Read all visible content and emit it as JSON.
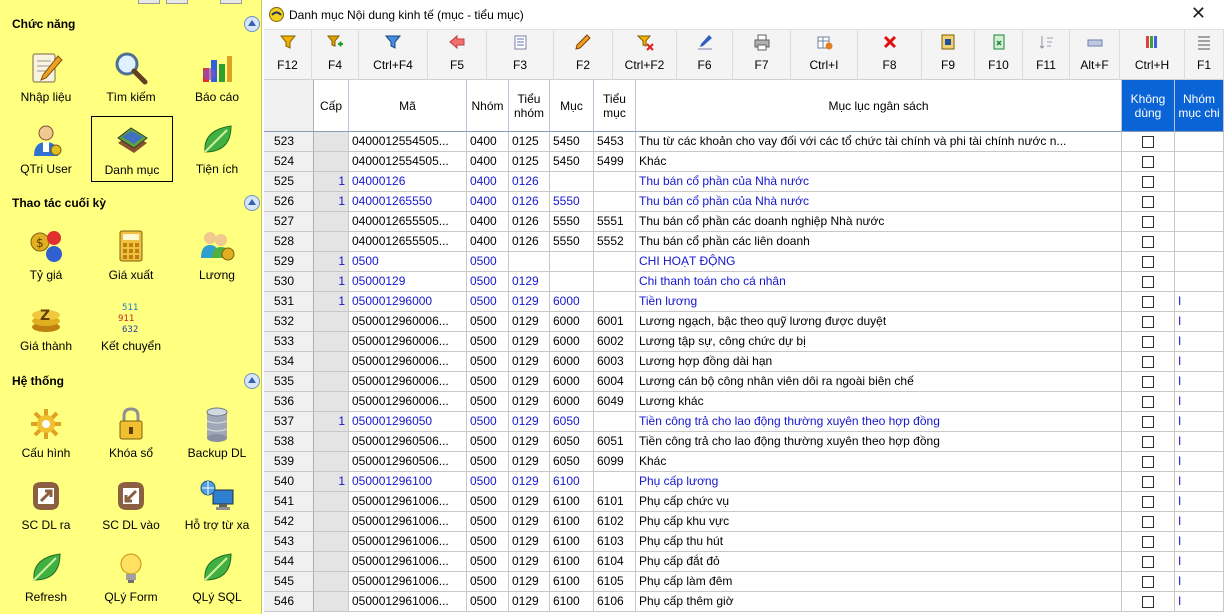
{
  "sidebar": {
    "sections": [
      {
        "title": "Chức năng",
        "items": [
          "Nhập liệu",
          "Tìm kiếm",
          "Báo cáo",
          "QTri User",
          "Danh mục",
          "Tiện ích"
        ]
      },
      {
        "title": "Thao tác cuối kỳ",
        "items": [
          "Tỷ giá",
          "Giá xuất",
          "Lương",
          "Giá thành",
          "Kết chuyển"
        ]
      },
      {
        "title": "Hệ thống",
        "items": [
          "Cấu hình",
          "Khóa sổ",
          "Backup DL",
          "SC DL ra",
          "SC DL vào",
          "Hỗ trợ từ xa",
          "Refresh",
          "QLý Form",
          "QLý SQL"
        ]
      }
    ],
    "selected": "Danh mục"
  },
  "window": {
    "title": "Danh mục Nội dung kinh tế (mục - tiểu mục)",
    "close": "✕"
  },
  "toolbar": [
    "F12",
    "F4",
    "Ctrl+F4",
    "F5",
    "F3",
    "F2",
    "Ctrl+F2",
    "F6",
    "F7",
    "Ctrl+I",
    "F8",
    "F9",
    "F10",
    "F11",
    "Alt+F",
    "Ctrl+H",
    "F1"
  ],
  "grid": {
    "columns": {
      "cap": "Cấp",
      "ma": "Mã",
      "nhom": "Nhóm",
      "tieu_nhom": "Tiểu nhóm",
      "muc": "Mục",
      "tieu_muc": "Tiểu mục",
      "muc_luc": "Mục lục ngân sách",
      "khong_dung": "Không dùng",
      "nhom_muc_chi": "Nhóm mục chi"
    },
    "rows": [
      {
        "n": "523",
        "cap": "",
        "ma": "0400012554505...",
        "nhom": "0400",
        "tn": "0125",
        "muc": "5450",
        "tm": "5453",
        "mlns": " Thu từ các khoản cho vay đối với các tổ chức tài chính và phi tài chính nước n...",
        "nmc": "",
        "blue": false
      },
      {
        "n": "524",
        "cap": "",
        "ma": "0400012554505...",
        "nhom": "0400",
        "tn": "0125",
        "muc": "5450",
        "tm": "5499",
        "mlns": " Khác",
        "nmc": "",
        "blue": false
      },
      {
        "n": "525",
        "cap": "1",
        "ma": "04000126",
        "nhom": "0400",
        "tn": "0126",
        "muc": "",
        "tm": "",
        "mlns": "Thu bán cổ phần của Nhà nước",
        "nmc": "",
        "blue": true
      },
      {
        "n": "526",
        "cap": "1",
        "ma": "040001265550",
        "nhom": "0400",
        "tn": "0126",
        "muc": "5550",
        "tm": "",
        "mlns": "Thu bán cổ phần của Nhà nước",
        "nmc": "",
        "blue": true
      },
      {
        "n": "527",
        "cap": "",
        "ma": "0400012655505...",
        "nhom": "0400",
        "tn": "0126",
        "muc": "5550",
        "tm": "5551",
        "mlns": " Thu bán cổ phần các doanh nghiệp Nhà nước",
        "nmc": "",
        "blue": false
      },
      {
        "n": "528",
        "cap": "",
        "ma": "0400012655505...",
        "nhom": "0400",
        "tn": "0126",
        "muc": "5550",
        "tm": "5552",
        "mlns": " Thu bán cổ phần các liên doanh",
        "nmc": "",
        "blue": false
      },
      {
        "n": "529",
        "cap": "1",
        "ma": "0500",
        "nhom": "0500",
        "tn": "",
        "muc": "",
        "tm": "",
        "mlns": "CHI HOẠT ĐỘNG",
        "nmc": "",
        "blue": true
      },
      {
        "n": "530",
        "cap": "1",
        "ma": "05000129",
        "nhom": "0500",
        "tn": "0129",
        "muc": "",
        "tm": "",
        "mlns": "Chi thanh toán cho cá nhân",
        "nmc": "",
        "blue": true
      },
      {
        "n": "531",
        "cap": "1",
        "ma": "050001296000",
        "nhom": "0500",
        "tn": "0129",
        "muc": "6000",
        "tm": "",
        "mlns": "Tiền lương",
        "nmc": "I",
        "blue": true
      },
      {
        "n": "532",
        "cap": "",
        "ma": "0500012960006...",
        "nhom": "0500",
        "tn": "0129",
        "muc": "6000",
        "tm": "6001",
        "mlns": " Lương ngạch, bậc theo quỹ lương được duyệt",
        "nmc": "I",
        "blue": false
      },
      {
        "n": "533",
        "cap": "",
        "ma": "0500012960006...",
        "nhom": "0500",
        "tn": "0129",
        "muc": "6000",
        "tm": "6002",
        "mlns": " Lương tập sự, công chức dự bị",
        "nmc": "I",
        "blue": false
      },
      {
        "n": "534",
        "cap": "",
        "ma": "0500012960006...",
        "nhom": "0500",
        "tn": "0129",
        "muc": "6000",
        "tm": "6003",
        "mlns": " Lương hợp đồng dài hạn",
        "nmc": "I",
        "blue": false
      },
      {
        "n": "535",
        "cap": "",
        "ma": "0500012960006...",
        "nhom": "0500",
        "tn": "0129",
        "muc": "6000",
        "tm": "6004",
        "mlns": " Lương cán bộ công nhân viên dôi ra ngoài biên chế",
        "nmc": "I",
        "blue": false
      },
      {
        "n": "536",
        "cap": "",
        "ma": "0500012960006...",
        "nhom": "0500",
        "tn": "0129",
        "muc": "6000",
        "tm": "6049",
        "mlns": " Lương khác",
        "nmc": "I",
        "blue": false
      },
      {
        "n": "537",
        "cap": "1",
        "ma": "050001296050",
        "nhom": "0500",
        "tn": "0129",
        "muc": "6050",
        "tm": "",
        "mlns": "Tiền công trả cho lao động thường xuyên theo hợp đồng",
        "nmc": "I",
        "blue": true
      },
      {
        "n": "538",
        "cap": "",
        "ma": "0500012960506...",
        "nhom": "0500",
        "tn": "0129",
        "muc": "6050",
        "tm": "6051",
        "mlns": " Tiền công trả cho lao động thường xuyên theo hợp đồng",
        "nmc": "I",
        "blue": false
      },
      {
        "n": "539",
        "cap": "",
        "ma": "0500012960506...",
        "nhom": "0500",
        "tn": "0129",
        "muc": "6050",
        "tm": "6099",
        "mlns": " Khác",
        "nmc": "I",
        "blue": false
      },
      {
        "n": "540",
        "cap": "1",
        "ma": "050001296100",
        "nhom": "0500",
        "tn": "0129",
        "muc": "6100",
        "tm": "",
        "mlns": "Phụ cấp lương",
        "nmc": "I",
        "blue": true
      },
      {
        "n": "541",
        "cap": "",
        "ma": "0500012961006...",
        "nhom": "0500",
        "tn": "0129",
        "muc": "6100",
        "tm": "6101",
        "mlns": " Phụ cấp chức vụ",
        "nmc": "I",
        "blue": false
      },
      {
        "n": "542",
        "cap": "",
        "ma": "0500012961006...",
        "nhom": "0500",
        "tn": "0129",
        "muc": "6100",
        "tm": "6102",
        "mlns": " Phụ cấp khu vực",
        "nmc": "I",
        "blue": false
      },
      {
        "n": "543",
        "cap": "",
        "ma": "0500012961006...",
        "nhom": "0500",
        "tn": "0129",
        "muc": "6100",
        "tm": "6103",
        "mlns": " Phụ cấp thu hút",
        "nmc": "I",
        "blue": false
      },
      {
        "n": "544",
        "cap": "",
        "ma": "0500012961006...",
        "nhom": "0500",
        "tn": "0129",
        "muc": "6100",
        "tm": "6104",
        "mlns": " Phụ cấp đắt đỏ",
        "nmc": "I",
        "blue": false
      },
      {
        "n": "545",
        "cap": "",
        "ma": "0500012961006...",
        "nhom": "0500",
        "tn": "0129",
        "muc": "6100",
        "tm": "6105",
        "mlns": " Phụ cấp làm đêm",
        "nmc": "I",
        "blue": false
      },
      {
        "n": "546",
        "cap": "",
        "ma": "0500012961006...",
        "nhom": "0500",
        "tn": "0129",
        "muc": "6100",
        "tm": "6106",
        "mlns": " Phụ cấp thêm giờ",
        "nmc": "I",
        "blue": false
      }
    ]
  }
}
